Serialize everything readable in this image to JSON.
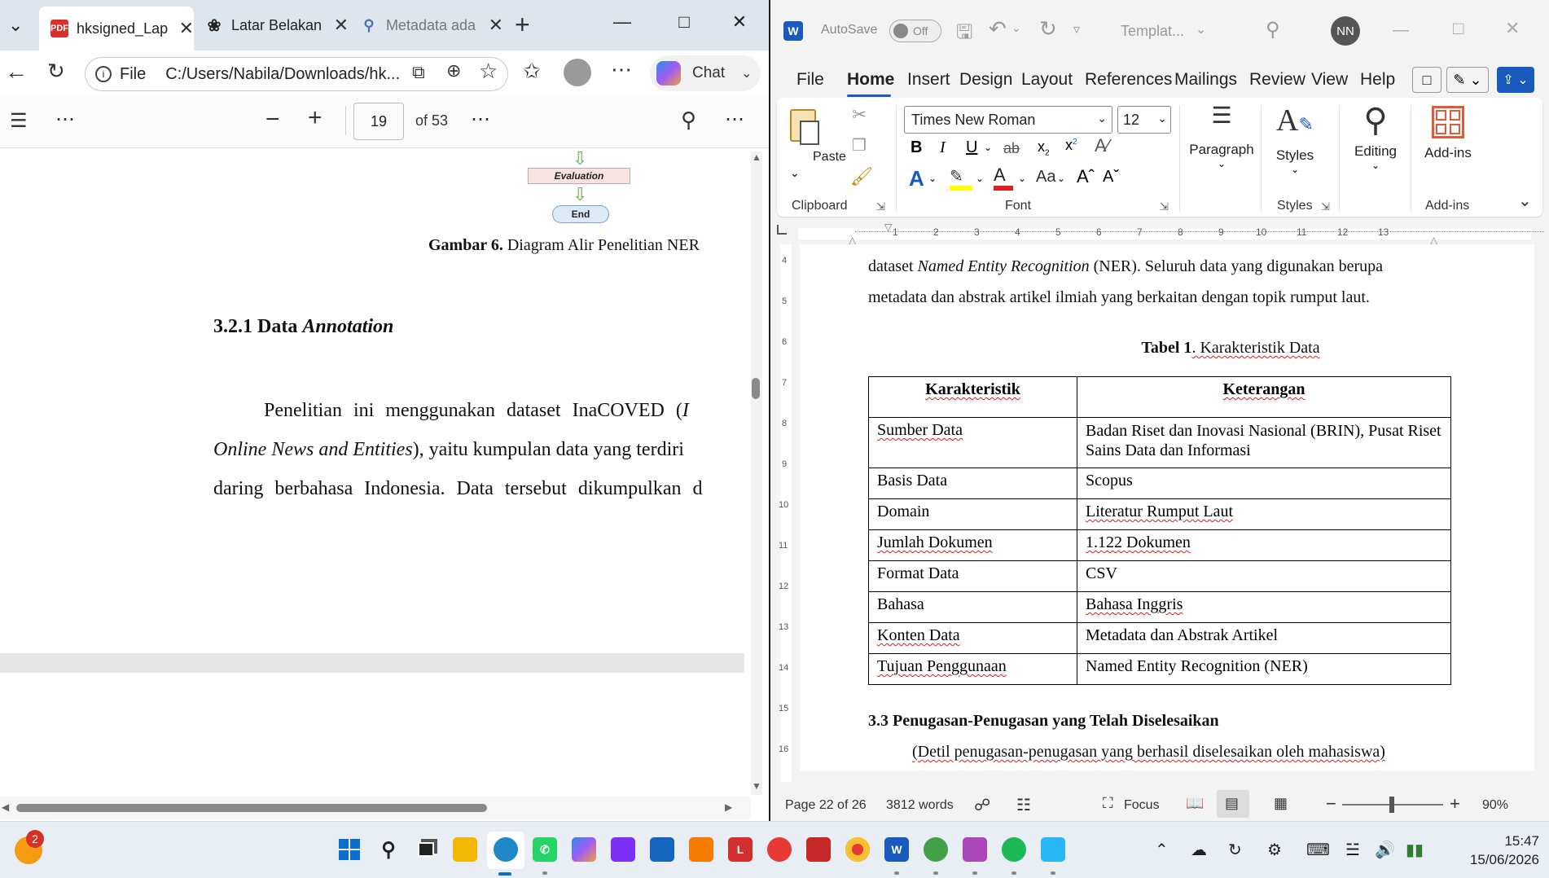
{
  "edge": {
    "tabs": [
      {
        "label": "hksigned_Lap",
        "icon": "pdf-icon"
      },
      {
        "label": "Latar Belakan",
        "icon": "chatgpt-icon"
      },
      {
        "label": "Metadata ada",
        "icon": "search-icon"
      }
    ],
    "address_prefix": "File",
    "address": "C:/Users/Nabila/Downloads/hk...",
    "chat_label": "Chat",
    "pdf": {
      "page_number": "19",
      "page_total": "of 53",
      "flow_evaluation": "Evaluation",
      "flow_end": "End",
      "figure_caption_bold": "Gambar 6.",
      "figure_caption": " Diagram Alir Penelitian NER",
      "section_heading_bold": "3.2.1 Data ",
      "section_heading_italic": "Annotation",
      "para_line1": "Penelitian ini menggunakan dataset InaCOVED (",
      "para_line1_cut": "I",
      "para_line2_italic": "Online News and Entities",
      "para_line2": "), yaitu kumpulan data yang terdiri",
      "para_line3": "daring berbahasa Indonesia. Data tersebut dikumpulkan d"
    }
  },
  "word": {
    "autosave_label": "AutoSave",
    "autosave_state": "Off",
    "doc_title": "Templat...",
    "user_initials": "NN",
    "menu": [
      "File",
      "Home",
      "Insert",
      "Design",
      "Layout",
      "References",
      "Mailings",
      "Review",
      "View",
      "Help"
    ],
    "ribbon": {
      "paste": "Paste",
      "clipboard": "Clipboard",
      "font_name": "Times New Roman",
      "font_size": "12",
      "font_group": "Font",
      "paragraph": "Paragraph",
      "styles": "Styles",
      "styles_group": "Styles",
      "editing": "Editing",
      "addins": "Add-ins",
      "addins_group": "Add-ins",
      "case_btn": "Aa"
    },
    "ruler_numbers": [
      "1",
      "2",
      "3",
      "4",
      "5",
      "6",
      "7",
      "8",
      "9",
      "10",
      "11",
      "12",
      "13"
    ],
    "vruler_numbers": [
      "4",
      "5",
      "6",
      "7",
      "8",
      "9",
      "10",
      "11",
      "12",
      "13",
      "14",
      "15",
      "16"
    ],
    "doc": {
      "line1_pre": "dataset ",
      "line1_italic": "Named Entity Recognition",
      "line1_post": " (NER). Seluruh data yang digunakan berupa",
      "line2": "metadata dan abstrak artikel ilmiah yang berkaitan dengan topik rumput laut.",
      "table_caption_bold": "Tabel 1",
      "table_caption": ". Karakteristik Data",
      "table_headers": [
        "Karakteristik",
        "Keterangan"
      ],
      "table_rows": [
        [
          "Sumber Data",
          "Badan Riset dan Inovasi Nasional (BRIN), Pusat Riset Sains Data dan Informasi"
        ],
        [
          "Basis Data",
          "Scopus"
        ],
        [
          "Domain",
          "Literatur Rumput Laut"
        ],
        [
          "Jumlah Dokumen",
          "1.122 Dokumen"
        ],
        [
          "Format Data",
          "CSV"
        ],
        [
          "Bahasa",
          "Bahasa Inggris"
        ],
        [
          "Konten Data",
          "Metadata dan Abstrak Artikel"
        ],
        [
          "Tujuan Penggunaan",
          "Named Entity Recognition (NER)"
        ]
      ],
      "section_heading": "3.3 Penugasan-Penugasan yang Telah Diselesaikan",
      "section_sub": "(Detil penugasan-penugasan yang berhasil diselesaikan oleh mahasiswa)"
    },
    "status": {
      "page": "Page 22 of 26",
      "words": "3812 words",
      "focus": "Focus",
      "zoom": "90%"
    }
  },
  "taskbar": {
    "weather_badge": "2",
    "time": "15:47",
    "date": "15/06/2026"
  }
}
